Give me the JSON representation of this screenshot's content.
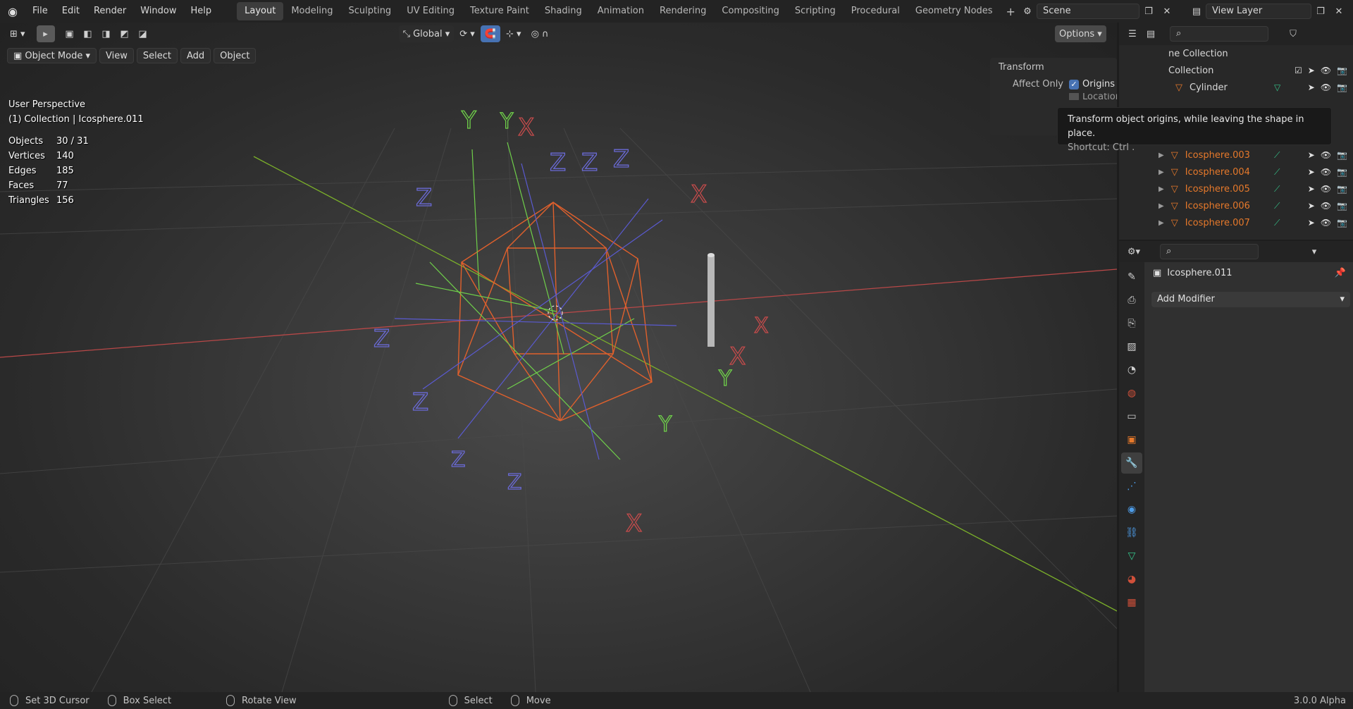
{
  "topbar": {
    "menus": [
      "File",
      "Edit",
      "Render",
      "Window",
      "Help"
    ],
    "workspaces": [
      "Layout",
      "Modeling",
      "Sculpting",
      "UV Editing",
      "Texture Paint",
      "Shading",
      "Animation",
      "Rendering",
      "Compositing",
      "Scripting",
      "Procedural",
      "Geometry Nodes"
    ],
    "active_workspace": "Layout",
    "scene": "Scene",
    "view_layer": "View Layer"
  },
  "viewport_header": {
    "orientation": "Global",
    "options": "Options",
    "mode": "Object Mode",
    "menus": [
      "View",
      "Select",
      "Add",
      "Object"
    ]
  },
  "overlay": {
    "perspective": "User Perspective",
    "collection_path": "(1) Collection | Icosphere.011",
    "stats": [
      {
        "label": "Objects",
        "value": "30 / 31"
      },
      {
        "label": "Vertices",
        "value": "140"
      },
      {
        "label": "Edges",
        "value": "185"
      },
      {
        "label": "Faces",
        "value": "77"
      },
      {
        "label": "Triangles",
        "value": "156"
      }
    ]
  },
  "transform_panel": {
    "title": "Transform",
    "affect_only": "Affect Only",
    "origins": "Origins",
    "locations": "Locations"
  },
  "tooltip": {
    "text": "Transform object origins, while leaving the shape in place.",
    "shortcut": "Shortcut: Ctrl ."
  },
  "outliner": {
    "scene_collection": "ne Collection",
    "collection": "Collection",
    "items": [
      "Cylinder",
      "Icosphere.003",
      "Icosphere.004",
      "Icosphere.005",
      "Icosphere.006",
      "Icosphere.007"
    ]
  },
  "properties": {
    "object_name": "Icosphere.011",
    "add_modifier": "Add Modifier"
  },
  "statusbar": {
    "items": [
      "Set 3D Cursor",
      "Box Select",
      "Rotate View",
      "Select",
      "Move"
    ],
    "version": "3.0.0 Alpha"
  },
  "colors": {
    "accent": "#4772b3",
    "object_orange": "#e6792b",
    "x_axis": "#c44b4b",
    "y_axis": "#7bb02a",
    "wire_orange": "#e0602c",
    "wire_green": "#6fcf4a",
    "wire_blue": "#5a5ad0"
  }
}
